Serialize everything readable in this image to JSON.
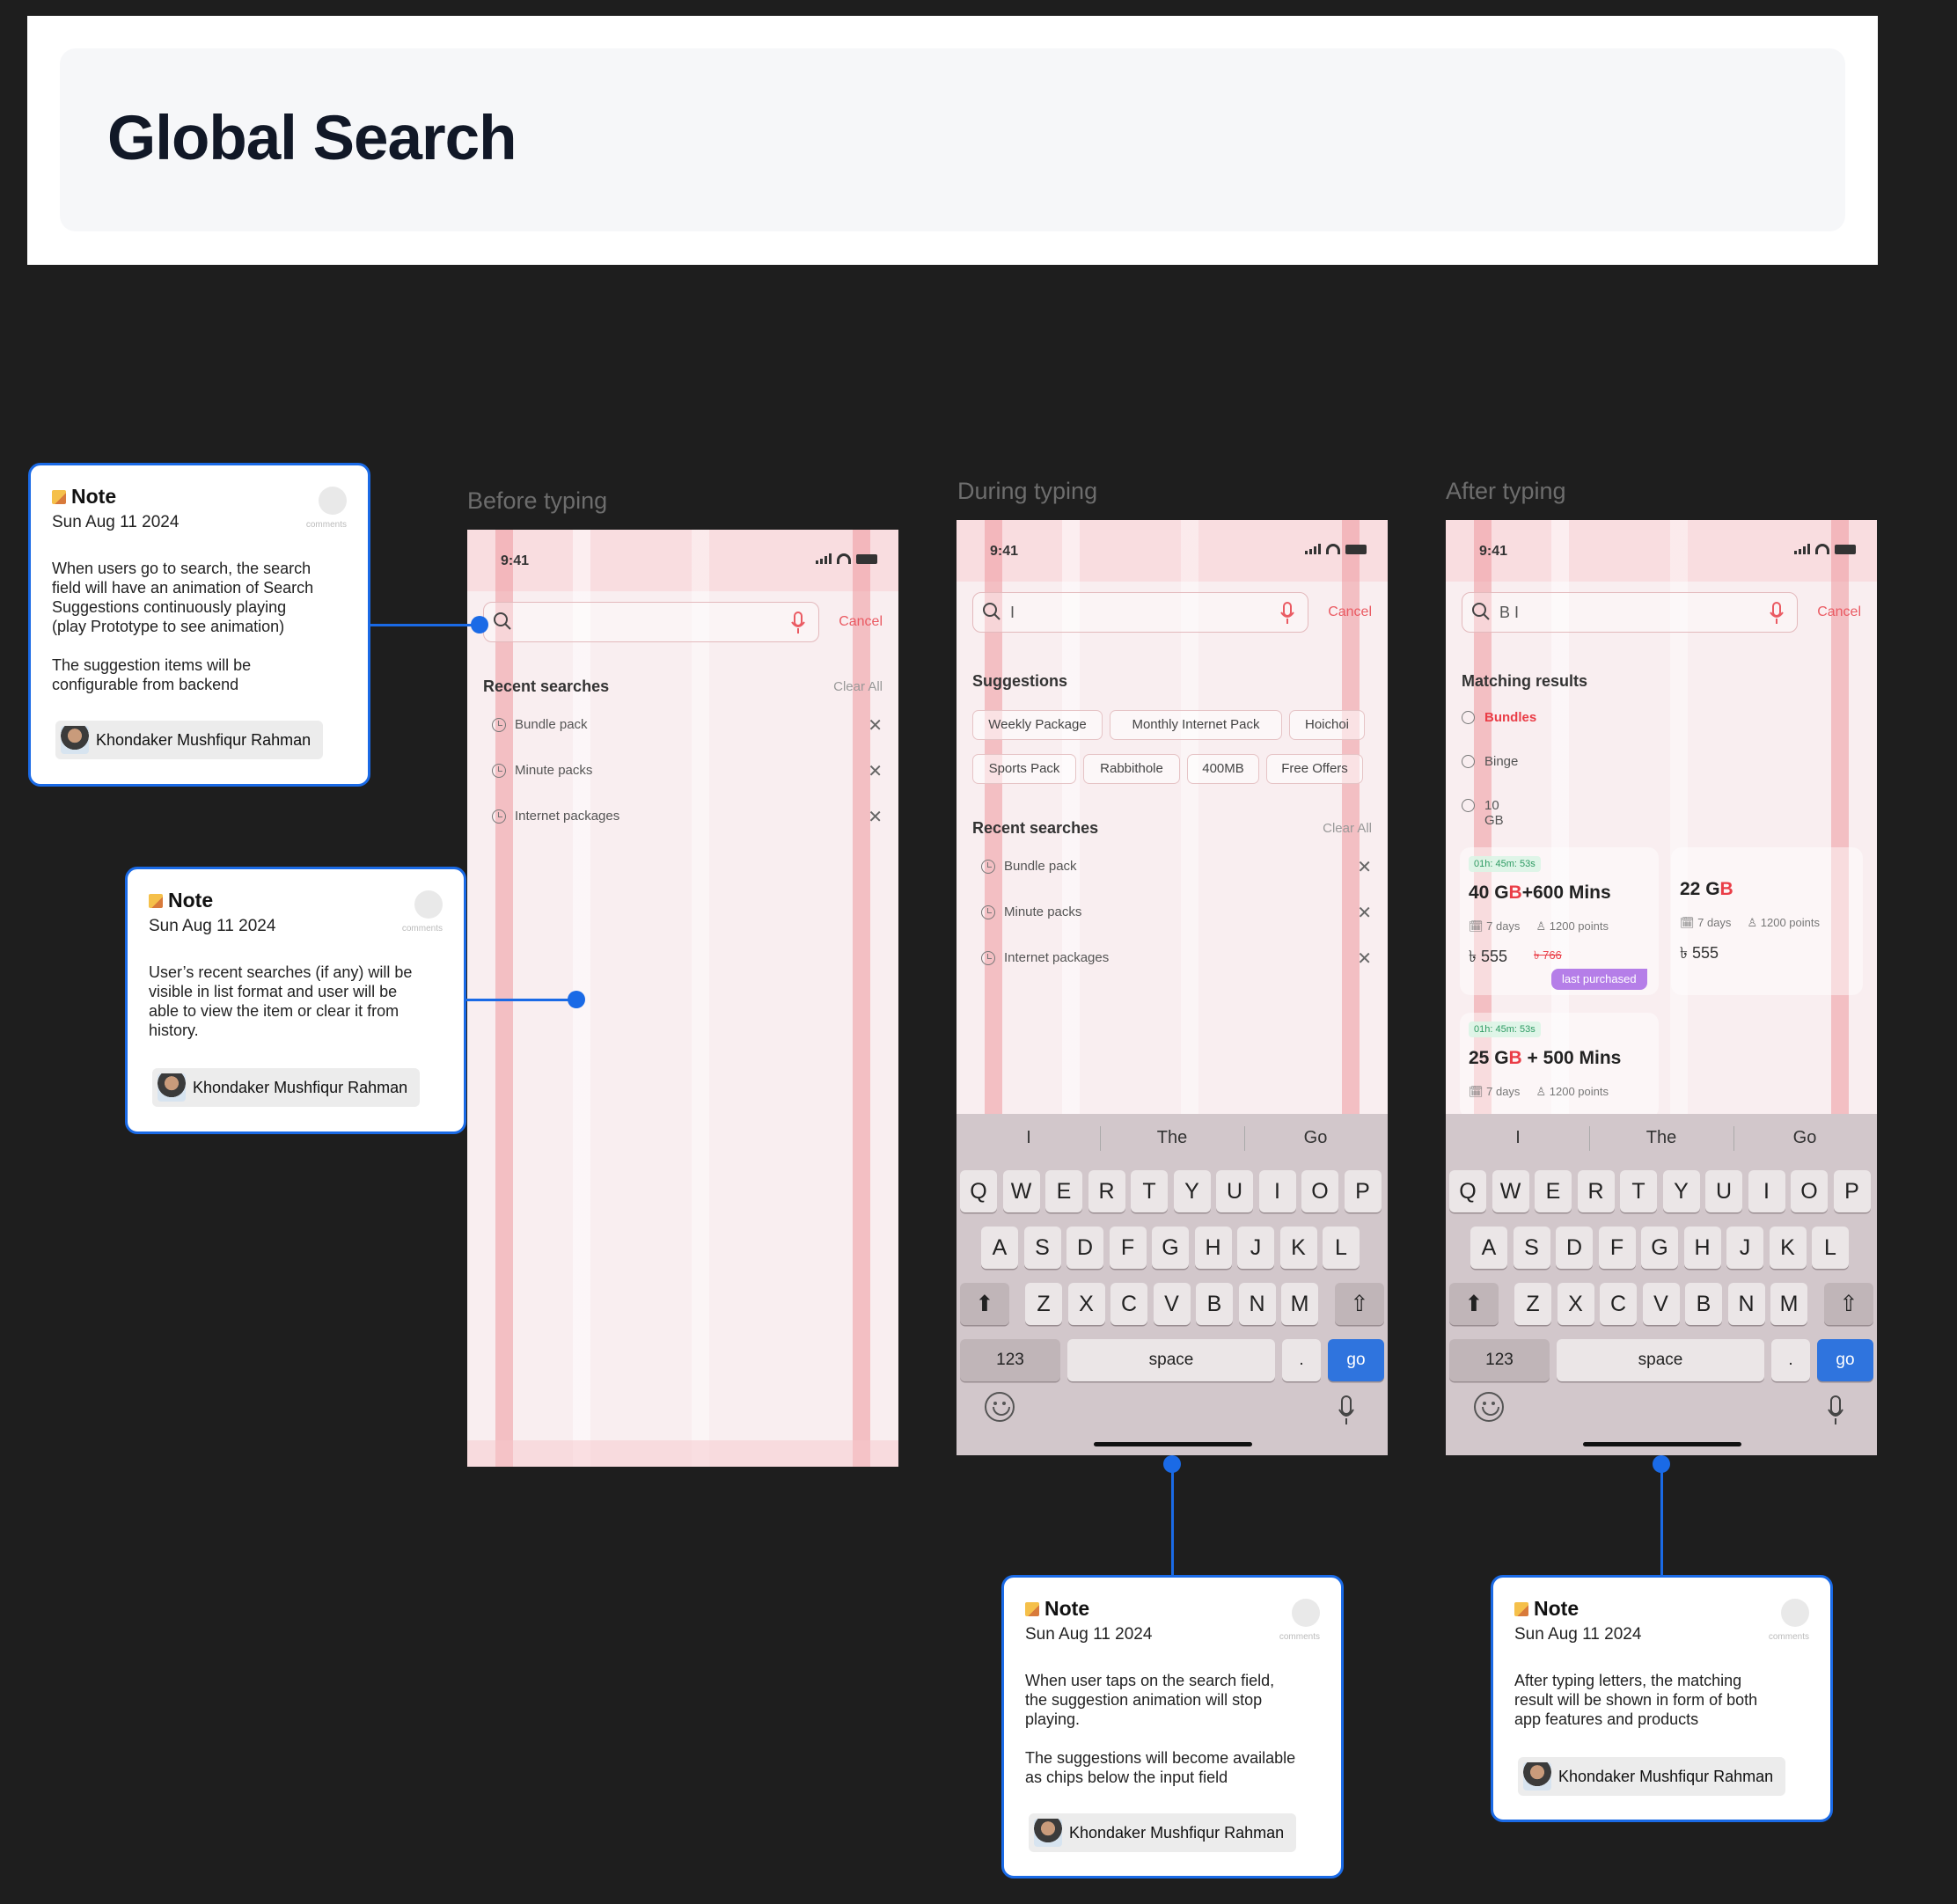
{
  "header": {
    "title": "Global Search"
  },
  "columns": {
    "before": "Before typing",
    "during": "During typing",
    "after": "After typing"
  },
  "status_time": "9:41",
  "cancel_label": "Cancel",
  "typed": {
    "during": "I",
    "after": "B I"
  },
  "recent": {
    "title": "Recent searches",
    "clear_all": "Clear All",
    "items": [
      "Bundle pack",
      "Minute packs",
      "Internet packages"
    ]
  },
  "suggestions": {
    "title": "Suggestions",
    "chips": [
      "Weekly Package",
      "Monthly Internet Pack",
      "Hoichoi",
      "Sports Pack",
      "Rabbithole",
      "400MB",
      "Free Offers"
    ]
  },
  "matching": {
    "title": "Matching results",
    "items": [
      "Bundles",
      "Binge",
      "10 GB"
    ]
  },
  "offers": [
    {
      "timer": "01h: 45m: 53s",
      "title_a": "40 G",
      "title_b": "B",
      "title_c": "+600 Mins",
      "days": "7 days",
      "points": "1200 points",
      "price": "৳ 555",
      "old_price": "৳ 766",
      "badge": "last purchased"
    },
    {
      "title_a": "22 G",
      "title_b": "B",
      "days": "7 days",
      "points": "1200 points",
      "price": "৳ 555"
    },
    {
      "timer": "01h: 45m: 53s",
      "title_a": "25 G",
      "title_b": "B",
      "title_c": " + 500 Mins",
      "days": "7 days",
      "points": "1200 points"
    }
  ],
  "keyboard": {
    "predictions": [
      "I",
      "The",
      "Go"
    ],
    "row1": [
      "Q",
      "W",
      "E",
      "R",
      "T",
      "Y",
      "U",
      "I",
      "O",
      "P"
    ],
    "row2": [
      "A",
      "S",
      "D",
      "F",
      "G",
      "H",
      "J",
      "K",
      "L"
    ],
    "row3": [
      "Z",
      "X",
      "C",
      "V",
      "B",
      "N",
      "M"
    ],
    "num": "123",
    "space": "space",
    "dot": ".",
    "go": "go"
  },
  "notes": [
    {
      "title": "Note",
      "date": "Sun Aug 11 2024",
      "comments": "comments",
      "body": "When users go to search, the search\nfield will have an animation of Search\nSuggestions continuously playing\n(play Prototype to see animation)\n\nThe suggestion items will be\nconfigurable from backend",
      "author": "Khondaker Mushfiqur Rahman"
    },
    {
      "title": "Note",
      "date": "Sun Aug 11 2024",
      "comments": "comments",
      "body": "User’s recent searches (if any) will be\nvisible in list format and user will be\nable to view the item or clear it from\nhistory.",
      "author": "Khondaker Mushfiqur Rahman"
    },
    {
      "title": "Note",
      "date": "Sun Aug 11 2024",
      "comments": "comments",
      "body": "When user taps on the search field,\nthe suggestion animation will stop\nplaying.\n\nThe suggestions will become available\nas chips below the input field",
      "author": "Khondaker Mushfiqur Rahman"
    },
    {
      "title": "Note",
      "date": "Sun Aug 11 2024",
      "comments": "comments",
      "body": "After typing letters, the matching\nresult will be shown in form of both\napp features and products",
      "author": "Khondaker Mushfiqur Rahman"
    }
  ],
  "colors": {
    "accent": "#ea3d47",
    "note_border": "#1a6ae6",
    "go_key": "#2f74de",
    "badge": "#b57ee8"
  }
}
